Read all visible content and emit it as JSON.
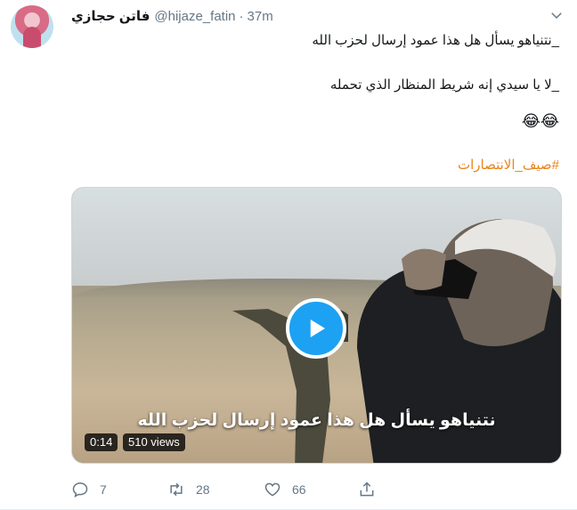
{
  "tweet": {
    "author_name": "فاتن حجازي",
    "handle": "@hijaze_fatin",
    "separator": "·",
    "time": "37m",
    "lines": [
      "_نتنياهو يسأل هل هذا عمود إرسال لحزب الله",
      "_لا يا سيدي إنه شريط المنظار الذي تحمله",
      "😂😂"
    ],
    "hashtag": "#صيف_الانتصارات"
  },
  "media": {
    "caption_overlay": "نتنياهو يسأل هل هذا عمود إرسال لحزب الله",
    "duration": "0:14",
    "views": "510 views",
    "play_icon": "play-icon"
  },
  "actions": {
    "reply_count": "7",
    "retweet_count": "28",
    "like_count": "66"
  },
  "colors": {
    "hashtag": "#e9841d",
    "play_button": "#1da1f2",
    "secondary_text": "#657786"
  }
}
